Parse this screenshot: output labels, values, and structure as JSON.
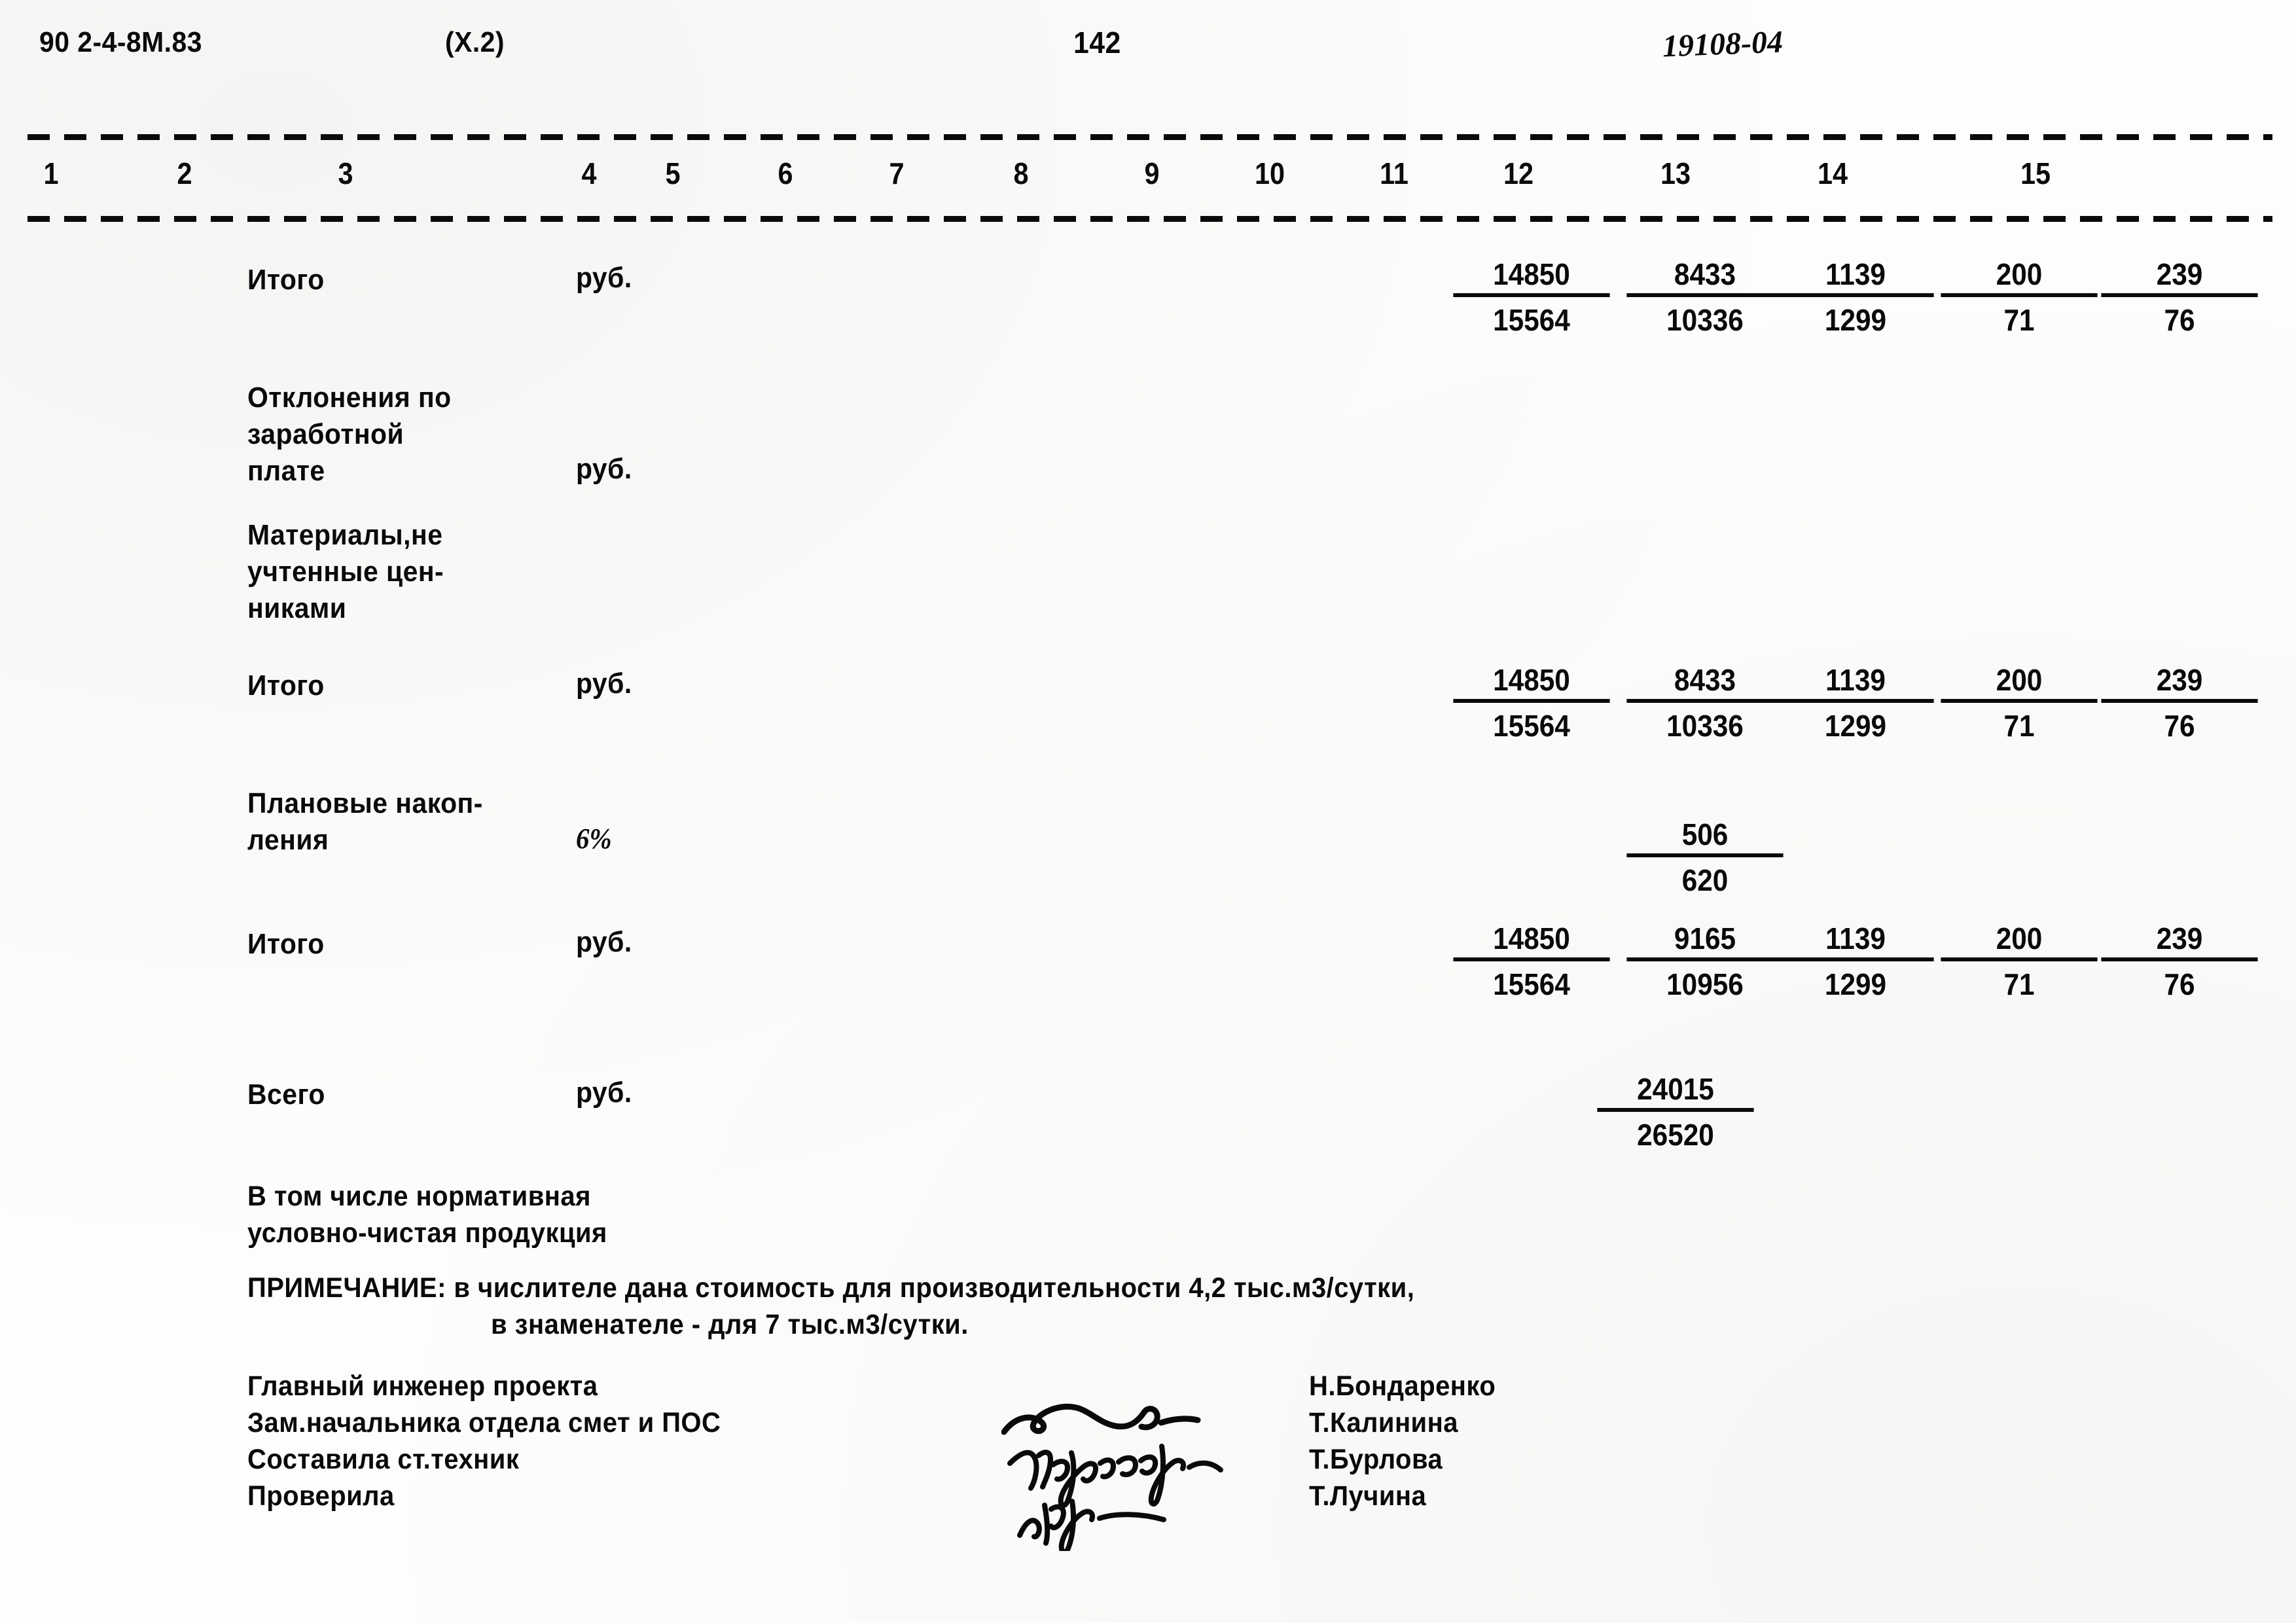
{
  "header": {
    "doc_code": "90 2-4-8М.83",
    "section": "(X.2)",
    "page_number": "142",
    "archive_mark": "19108-04"
  },
  "table": {
    "column_numbers": [
      "1",
      "2",
      "3",
      "4",
      "5",
      "6",
      "7",
      "8",
      "9",
      "10",
      "11",
      "12",
      "13",
      "14",
      "15"
    ],
    "rows": [
      {
        "label": "Итого",
        "unit": "руб.",
        "unit_style": "normal",
        "values": [
          {
            "col": 12,
            "numerator": "14850",
            "denominator": "15564"
          },
          {
            "col": 13,
            "numerator": "8433",
            "denominator": "10336"
          },
          {
            "col": 14,
            "numerator": "1139",
            "denominator": "1299"
          },
          {
            "col": 15,
            "numerator": "200",
            "denominator": "71"
          },
          {
            "col": 16,
            "numerator": "239",
            "denominator": "76"
          }
        ]
      },
      {
        "label": "Отклонения по\nзаработной\nплате",
        "unit": "руб.",
        "unit_style": "normal",
        "values": []
      },
      {
        "label": "Материалы,не\nучтенные цен-\nниками",
        "unit": "",
        "unit_style": "normal",
        "values": []
      },
      {
        "label": "Итого",
        "unit": "руб.",
        "unit_style": "normal",
        "values": [
          {
            "col": 12,
            "numerator": "14850",
            "denominator": "15564"
          },
          {
            "col": 13,
            "numerator": "8433",
            "denominator": "10336"
          },
          {
            "col": 14,
            "numerator": "1139",
            "denominator": "1299"
          },
          {
            "col": 15,
            "numerator": "200",
            "denominator": "71"
          },
          {
            "col": 16,
            "numerator": "239",
            "denominator": "76"
          }
        ]
      },
      {
        "label": "Плановые накоп-\nления",
        "unit": "6%",
        "unit_style": "italic",
        "values": [
          {
            "col": 13,
            "numerator": "506",
            "denominator": "620"
          }
        ]
      },
      {
        "label": "Итого",
        "unit": "руб.",
        "unit_style": "normal",
        "values": [
          {
            "col": 12,
            "numerator": "14850",
            "denominator": "15564"
          },
          {
            "col": 13,
            "numerator": "9165",
            "denominator": "10956"
          },
          {
            "col": 14,
            "numerator": "1139",
            "denominator": "1299"
          },
          {
            "col": 15,
            "numerator": "200",
            "denominator": "71"
          },
          {
            "col": 16,
            "numerator": "239",
            "denominator": "76"
          }
        ]
      },
      {
        "label": "Всего",
        "unit": "руб.",
        "unit_style": "normal",
        "values": [
          {
            "col": 0,
            "numerator": "24015",
            "denominator": "26520"
          }
        ]
      }
    ]
  },
  "footer": {
    "nchp_line1": "В том числе нормативная",
    "nchp_line2": "условно-чистая продукция",
    "note_line1": "ПРИМЕЧАНИЕ: в числителе дана стоимость для производительности 4,2 тыс.м3/сутки,",
    "note_line2": "в знаменателе - для 7 тыс.м3/сутки.",
    "signatures": [
      {
        "role": "Главный инженер проекта",
        "name": "Н.Бондаренко"
      },
      {
        "role": "Зам.начальника отдела смет и ПОС",
        "name": "Т.Калинина"
      },
      {
        "role": "Составила ст.техник",
        "name": "Т.Бурлова"
      },
      {
        "role": "Проверила",
        "name": "Т.Лучина"
      }
    ]
  }
}
